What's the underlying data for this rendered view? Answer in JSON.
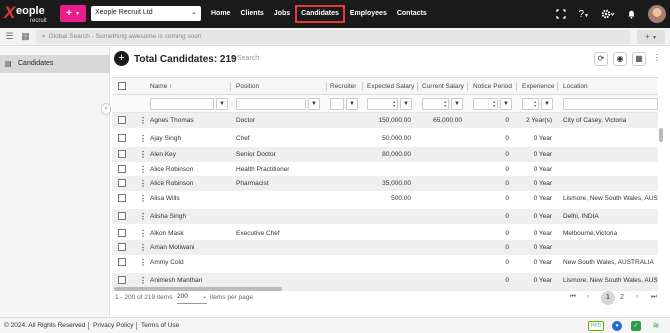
{
  "nav": {
    "logo_brand": "eople",
    "logo_sub": "recruit",
    "add_label": "+",
    "company": "Xeople Recruit Ltd",
    "links": [
      "Home",
      "Clients",
      "Jobs",
      "Candidates",
      "Employees",
      "Contacts"
    ],
    "active_link": "Candidates",
    "accent": "#e91e8c"
  },
  "search": {
    "placeholder": "Global Search - Something awesome is coming soon",
    "plus_label": "+"
  },
  "sidebar": {
    "items": [
      {
        "label": "Candidates",
        "icon": "contacts-icon"
      }
    ]
  },
  "header": {
    "title": "Total Candidates: 219",
    "search_placeholder": "Search"
  },
  "table": {
    "columns": [
      "Name",
      "Position",
      "Recruiter",
      "Expected Salary",
      "Current Salary",
      "Notice Period",
      "Experience",
      "Location"
    ],
    "sort_indicator": "↑",
    "rows": [
      {
        "name": "Agnes Thomas",
        "position": "Doctor",
        "recruiter": "",
        "expected": "150,000.00",
        "current": "65,000.00",
        "notice": "0",
        "experience": "2 Year(s)",
        "location": "City of Casey, Victoria"
      },
      {
        "name": "Ajay Singh",
        "position": "Chef",
        "recruiter": "",
        "expected": "50,000.00",
        "current": "",
        "notice": "0",
        "experience": "0 Year",
        "location": ""
      },
      {
        "name": "Alen Key",
        "position": "Senior Doctor",
        "recruiter": "",
        "expected": "80,000.00",
        "current": "",
        "notice": "0",
        "experience": "0 Year",
        "location": ""
      },
      {
        "name": "Alice Robinson",
        "position": "Health Practitioner",
        "recruiter": "",
        "expected": "",
        "current": "",
        "notice": "0",
        "experience": "0 Year",
        "location": ""
      },
      {
        "name": "Alice Robinson",
        "position": "Pharmacist",
        "recruiter": "",
        "expected": "35,000.00",
        "current": "",
        "notice": "0",
        "experience": "0 Year",
        "location": ""
      },
      {
        "name": "Alisa Wills",
        "position": "",
        "recruiter": "",
        "expected": "500.00",
        "current": "",
        "notice": "0",
        "experience": "0 Year",
        "location": "Lismore, New South Wales, AUSTRA"
      },
      {
        "name": "Alisha Singh",
        "position": "",
        "recruiter": "",
        "expected": "",
        "current": "",
        "notice": "0",
        "experience": "0 Year",
        "location": "Delhi, INDIA"
      },
      {
        "name": "Alkon Mask",
        "position": "Executive Chef",
        "recruiter": "",
        "expected": "",
        "current": "",
        "notice": "0",
        "experience": "0 Year",
        "location": "Melbourne,Victoria"
      },
      {
        "name": "Aman Motiwani",
        "position": "",
        "recruiter": "",
        "expected": "",
        "current": "",
        "notice": "0",
        "experience": "0 Year",
        "location": ""
      },
      {
        "name": "Ammy Cold",
        "position": "",
        "recruiter": "",
        "expected": "",
        "current": "",
        "notice": "0",
        "experience": "0 Year",
        "location": "New South Wales, AUSTRALIA"
      },
      {
        "name": "Animesh Manthan",
        "position": "",
        "recruiter": "",
        "expected": "",
        "current": "",
        "notice": "0",
        "experience": "0 Year",
        "location": "Lismore, New South Wales, AUSTRA"
      }
    ]
  },
  "pager": {
    "range": "1 - 200 of 219 items",
    "page_size": "200",
    "per_page_label": "items per page",
    "pages": [
      "1",
      "2"
    ],
    "current_page": "1"
  },
  "footer": {
    "copyright": "© 2024. All Rights Reserved",
    "privacy": "Privacy Policy",
    "terms": "Terms of Use",
    "badge": "PPD"
  }
}
